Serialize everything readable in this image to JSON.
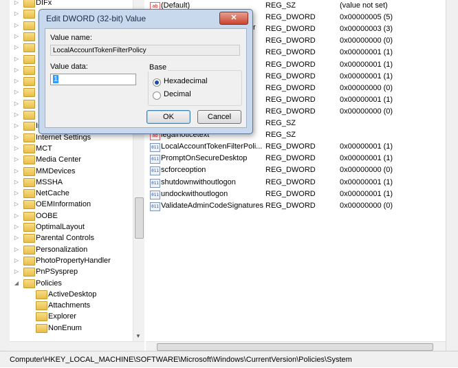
{
  "tree": {
    "items": [
      {
        "label": "DIFx",
        "indent": 0
      },
      {
        "label": "",
        "indent": 0
      },
      {
        "label": "",
        "indent": 0
      },
      {
        "label": "",
        "indent": 0
      },
      {
        "label": "",
        "indent": 0
      },
      {
        "label": "",
        "indent": 0
      },
      {
        "label": "",
        "indent": 0
      },
      {
        "label": "",
        "indent": 0
      },
      {
        "label": "",
        "indent": 0
      },
      {
        "label": "",
        "indent": 0
      },
      {
        "label": "",
        "indent": 0
      },
      {
        "label": "Installer",
        "indent": 0
      },
      {
        "label": "Internet Settings",
        "indent": 0
      },
      {
        "label": "MCT",
        "indent": 0
      },
      {
        "label": "Media Center",
        "indent": 0
      },
      {
        "label": "MMDevices",
        "indent": 0
      },
      {
        "label": "MSSHA",
        "indent": 0
      },
      {
        "label": "NetCache",
        "indent": 0
      },
      {
        "label": "OEMInformation",
        "indent": 0
      },
      {
        "label": "OOBE",
        "indent": 0
      },
      {
        "label": "OptimalLayout",
        "indent": 0
      },
      {
        "label": "Parental Controls",
        "indent": 0
      },
      {
        "label": "Personalization",
        "indent": 0
      },
      {
        "label": "PhotoPropertyHandler",
        "indent": 0
      },
      {
        "label": "PnPSysprep",
        "indent": 0
      },
      {
        "label": "Policies",
        "indent": 0,
        "expanded": true
      },
      {
        "label": "ActiveDesktop",
        "indent": 1
      },
      {
        "label": "Attachments",
        "indent": 1
      },
      {
        "label": "Explorer",
        "indent": 1
      },
      {
        "label": "NonEnum",
        "indent": 1
      }
    ]
  },
  "values": {
    "rows": [
      {
        "name": "(Default)",
        "type": "REG_SZ",
        "data": "(value not set)",
        "kind": "sz"
      },
      {
        "name": "",
        "type": "REG_DWORD",
        "data": "0x00000005 (5)",
        "kind": "dword"
      },
      {
        "name": "",
        "type": "REG_DWORD",
        "data": "0x00000003 (3)",
        "kind": "dword"
      },
      {
        "name": "",
        "type": "REG_DWORD",
        "data": "0x00000000 (0)",
        "kind": "dword"
      },
      {
        "name": "",
        "type": "REG_DWORD",
        "data": "0x00000001 (1)",
        "kind": "dword"
      },
      {
        "name": "",
        "type": "REG_DWORD",
        "data": "0x00000001 (1)",
        "kind": "dword"
      },
      {
        "name": "",
        "type": "REG_DWORD",
        "data": "0x00000001 (1)",
        "kind": "dword"
      },
      {
        "name": "",
        "type": "REG_DWORD",
        "data": "0x00000000 (0)",
        "kind": "dword"
      },
      {
        "name": "",
        "type": "REG_DWORD",
        "data": "0x00000001 (1)",
        "kind": "dword"
      },
      {
        "name": "",
        "type": "REG_DWORD",
        "data": "0x00000000 (0)",
        "kind": "dword"
      },
      {
        "name": "",
        "type": "REG_SZ",
        "data": "",
        "kind": "sz"
      },
      {
        "name": "legalnoticetext",
        "type": "REG_SZ",
        "data": "",
        "kind": "sz"
      },
      {
        "name": "LocalAccountTokenFilterPoli...",
        "type": "REG_DWORD",
        "data": "0x00000001 (1)",
        "kind": "dword"
      },
      {
        "name": "PromptOnSecureDesktop",
        "type": "REG_DWORD",
        "data": "0x00000001 (1)",
        "kind": "dword"
      },
      {
        "name": "scforceoption",
        "type": "REG_DWORD",
        "data": "0x00000000 (0)",
        "kind": "dword"
      },
      {
        "name": "shutdownwithoutlogon",
        "type": "REG_DWORD",
        "data": "0x00000001 (1)",
        "kind": "dword"
      },
      {
        "name": "undockwithoutlogon",
        "type": "REG_DWORD",
        "data": "0x00000001 (1)",
        "kind": "dword"
      },
      {
        "name": "ValidateAdminCodeSignatures",
        "type": "REG_DWORD",
        "data": "0x00000000 (0)",
        "kind": "dword"
      }
    ],
    "partial_name_row2": "r"
  },
  "status_bar": {
    "path": "Computer\\HKEY_LOCAL_MACHINE\\SOFTWARE\\Microsoft\\Windows\\CurrentVersion\\Policies\\System"
  },
  "dialog": {
    "title": "Edit DWORD (32-bit) Value",
    "close_label": "✕",
    "value_name_label": "Value name:",
    "value_name": "LocalAccountTokenFilterPolicy",
    "value_data_label": "Value data:",
    "value_data": "1",
    "base_label": "Base",
    "base_options": [
      {
        "label": "Hexadecimal",
        "selected": true
      },
      {
        "label": "Decimal",
        "selected": false
      }
    ],
    "ok_label": "OK",
    "cancel_label": "Cancel"
  }
}
